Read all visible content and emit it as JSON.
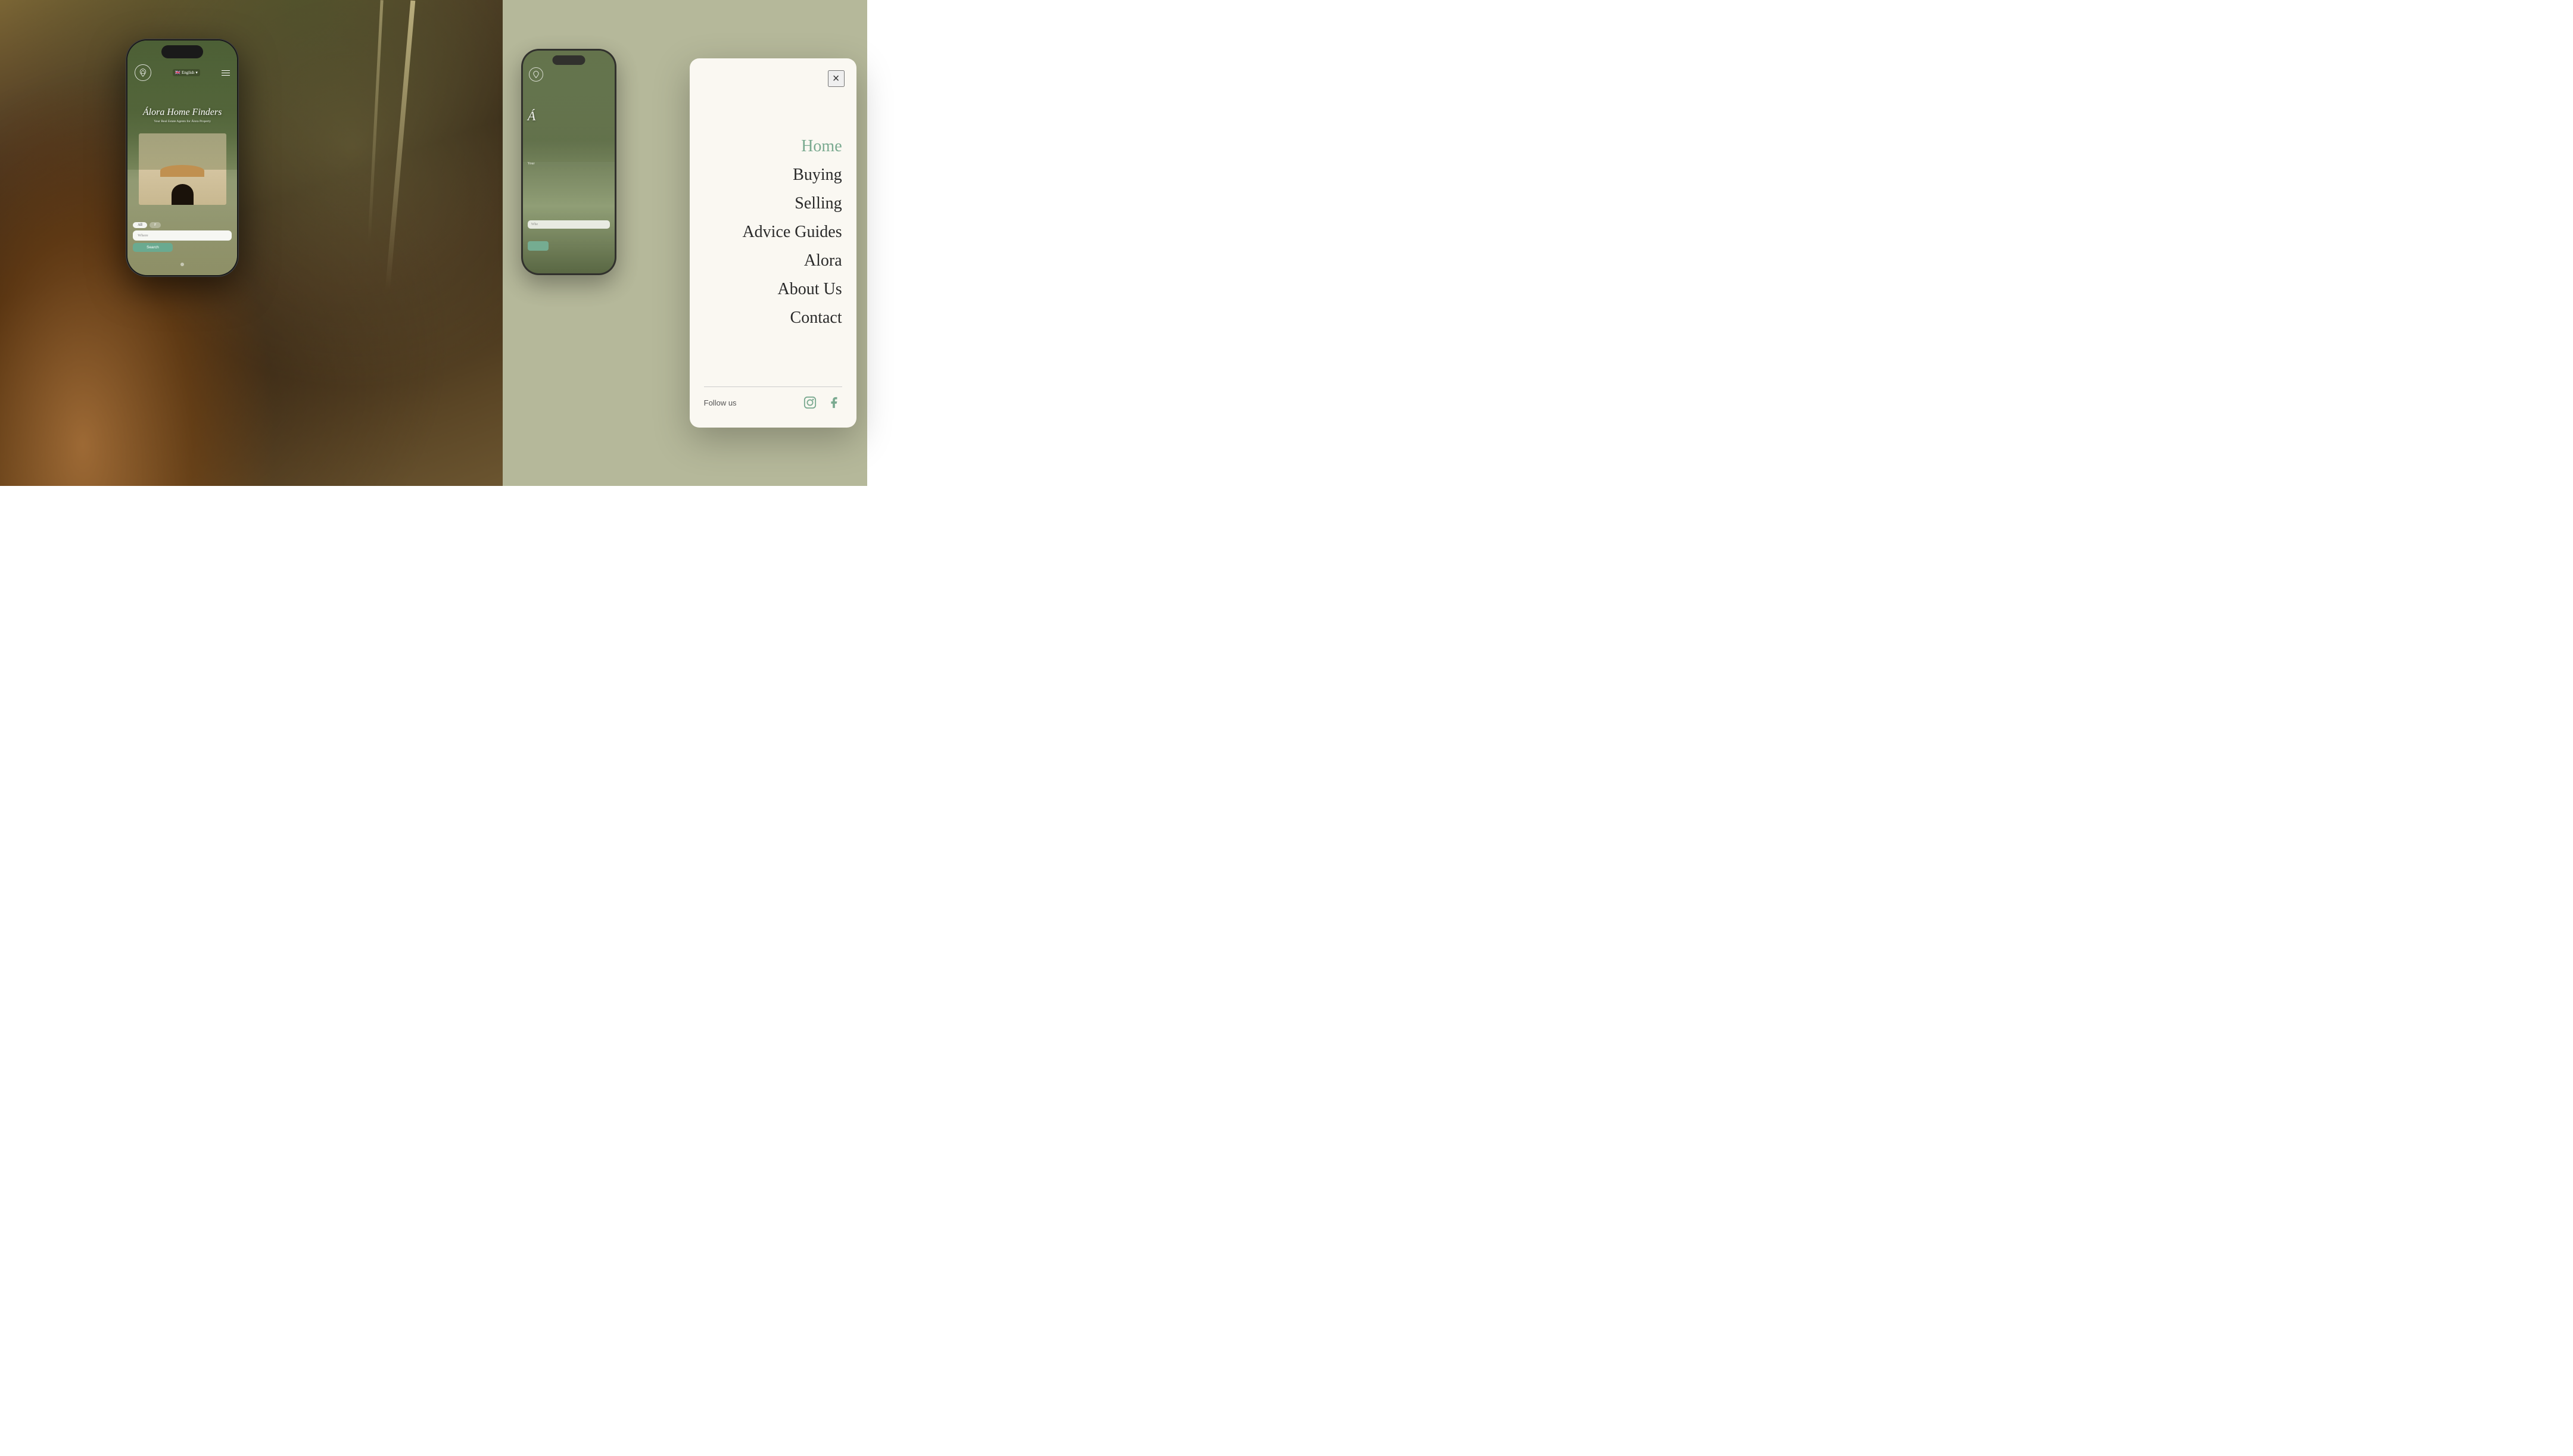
{
  "app": {
    "title": "Álora Home Finders"
  },
  "left_phone": {
    "lang_label": "English",
    "flag": "🇬🇧",
    "hero_title": "Álora Home Finders",
    "hero_subtitle": "Your Real Estate Agents for Álora Property",
    "tabs": [
      "All",
      "F"
    ],
    "search_placeholder": "Where",
    "search_button": "Search"
  },
  "menu_overlay": {
    "close_label": "×",
    "nav_items": [
      {
        "label": "Home",
        "active": true
      },
      {
        "label": "Buying",
        "active": false
      },
      {
        "label": "Selling",
        "active": false
      },
      {
        "label": "Advice Guides",
        "active": false
      },
      {
        "label": "Alora",
        "active": false
      },
      {
        "label": "About Us",
        "active": false
      },
      {
        "label": "Contact",
        "active": false
      }
    ],
    "follow_us_label": "Follow us",
    "social": {
      "instagram": "Instagram",
      "facebook": "Facebook"
    }
  },
  "colors": {
    "accent": "#7aaa90",
    "menu_bg": "#faf8f2",
    "right_bg": "#b5b89a",
    "active_nav": "#7aaa90",
    "text_dark": "#2a2a2a"
  }
}
